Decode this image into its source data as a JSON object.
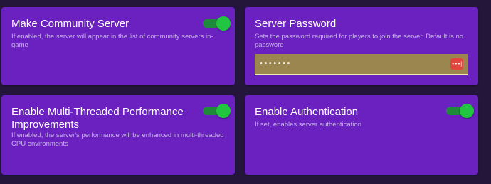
{
  "settings": [
    {
      "title": "Make Community Server",
      "description": "If enabled, the server will appear in the list of community servers in-game",
      "toggle_on": true
    },
    {
      "title": "Server Password",
      "description": "Sets the password required for players to join the server. Default is no password",
      "password_mask": "•••••••",
      "icon": "password-manager-icon"
    },
    {
      "title": "Enable Multi-Threaded Performance Improvements",
      "description": "If enabled, the server's performance will be enhanced in multi-threaded CPU environments",
      "toggle_on": true
    },
    {
      "title": "Enable Authentication",
      "description": "If set, enables server authentication",
      "toggle_on": true
    }
  ],
  "colors": {
    "background": "#24163a",
    "card": "#6a21c0",
    "toggle_on": "#22c540",
    "password_field": "#9c8650",
    "password_icon": "#e0463f"
  }
}
